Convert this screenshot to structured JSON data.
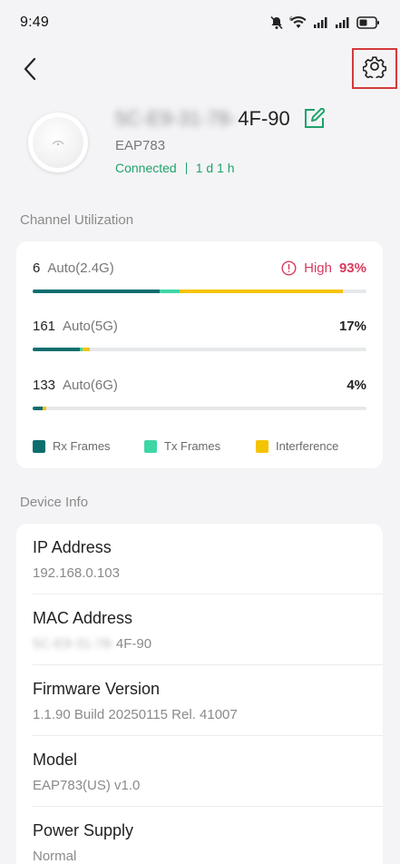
{
  "status_bar": {
    "time": "9:49",
    "icons": [
      "mute-icon",
      "wifi-icon",
      "signal-icon",
      "signal-icon",
      "battery-icon"
    ]
  },
  "nav": {
    "back_icon": "back-chevron-icon",
    "settings_icon": "gear-icon"
  },
  "device": {
    "name_hidden": "5C-E9-31-78-",
    "name_visible": "4F-90",
    "model": "EAP783",
    "status": "Connected",
    "uptime": "1 d 1 h",
    "status_color": "#1fa36b"
  },
  "channel_utilization": {
    "title": "Channel Utilization",
    "channels": [
      {
        "channel": "6",
        "band": "Auto(2.4G)",
        "level": "High",
        "percent": "93%",
        "rx": 0.38,
        "tx": 0.06,
        "interference": 0.49,
        "warning": true
      },
      {
        "channel": "161",
        "band": "Auto(5G)",
        "level": "",
        "percent": "17%",
        "rx": 0.14,
        "tx": 0.01,
        "interference": 0.02,
        "warning": false
      },
      {
        "channel": "133",
        "band": "Auto(6G)",
        "level": "",
        "percent": "4%",
        "rx": 0.03,
        "tx": 0.0,
        "interference": 0.01,
        "warning": false
      }
    ],
    "legend": [
      {
        "label": "Rx Frames",
        "color": "#0d6e6e"
      },
      {
        "label": "Tx Frames",
        "color": "#3fd6a6"
      },
      {
        "label": "Interference",
        "color": "#f5c400"
      }
    ],
    "high_color": "#d93a5e"
  },
  "device_info": {
    "title": "Device Info",
    "items": [
      {
        "label": "IP Address",
        "value": "192.168.0.103"
      },
      {
        "label": "MAC Address",
        "value_hidden": "5C-E9-31-78-",
        "value": "4F-90"
      },
      {
        "label": "Firmware Version",
        "value": "1.1.90 Build 20250115 Rel. 41007"
      },
      {
        "label": "Model",
        "value": "EAP783(US) v1.0"
      },
      {
        "label": "Power Supply",
        "value": "Normal"
      }
    ]
  }
}
